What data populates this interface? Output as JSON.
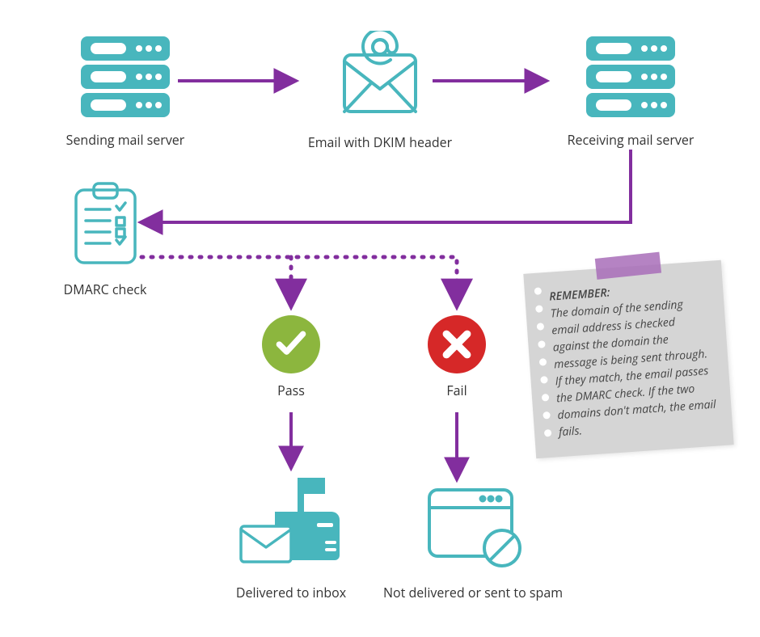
{
  "colors": {
    "teal": "#48b6bd",
    "purple": "#822e9e",
    "green": "#8cb63e",
    "red": "#d62828",
    "grey_note": "#d5d5d5"
  },
  "nodes": {
    "sending_server": "Sending mail server",
    "email_dkim": "Email with DKIM header",
    "receiving_server": "Receiving mail server",
    "dmarc_check": "DMARC check",
    "pass": "Pass",
    "fail": "Fail",
    "delivered": "Delivered to inbox",
    "not_delivered": "Not delivered or sent to spam"
  },
  "note": {
    "heading": "REMEMBER:",
    "body": "The domain of the sending email address is checked against the domain the message is being sent through. If they match, the email passes the DMARC check. If the two domains don't match, the email fails."
  }
}
